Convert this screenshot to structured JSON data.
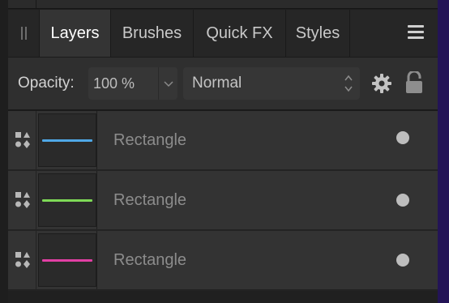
{
  "tabs": [
    {
      "label": "Layers",
      "active": true
    },
    {
      "label": "Brushes",
      "active": false
    },
    {
      "label": "Quick FX",
      "active": false
    },
    {
      "label": "Styles",
      "active": false
    }
  ],
  "icons": {
    "grip": "drag-handle-icon",
    "menu": "hamburger-menu-icon",
    "gear": "gear-icon",
    "lock": "lock-icon",
    "layer_type": "shapes-icon",
    "opacity_chevron": "chevron-down-icon",
    "blend_stepper": "up-down-stepper-icon"
  },
  "options": {
    "opacity_label": "Opacity:",
    "opacity_value": "100 %",
    "blend_mode": "Normal"
  },
  "layers": [
    {
      "name": "Rectangle",
      "stroke_color": "#4fa8e6",
      "visible": true
    },
    {
      "name": "Rectangle",
      "stroke_color": "#7ed957",
      "visible": true
    },
    {
      "name": "Rectangle",
      "stroke_color": "#e23fa4",
      "visible": true
    }
  ],
  "colors": {
    "panel_bg": "#2a2a2a",
    "active_tab_bg": "#343434",
    "desktop_edge": "#231456"
  }
}
